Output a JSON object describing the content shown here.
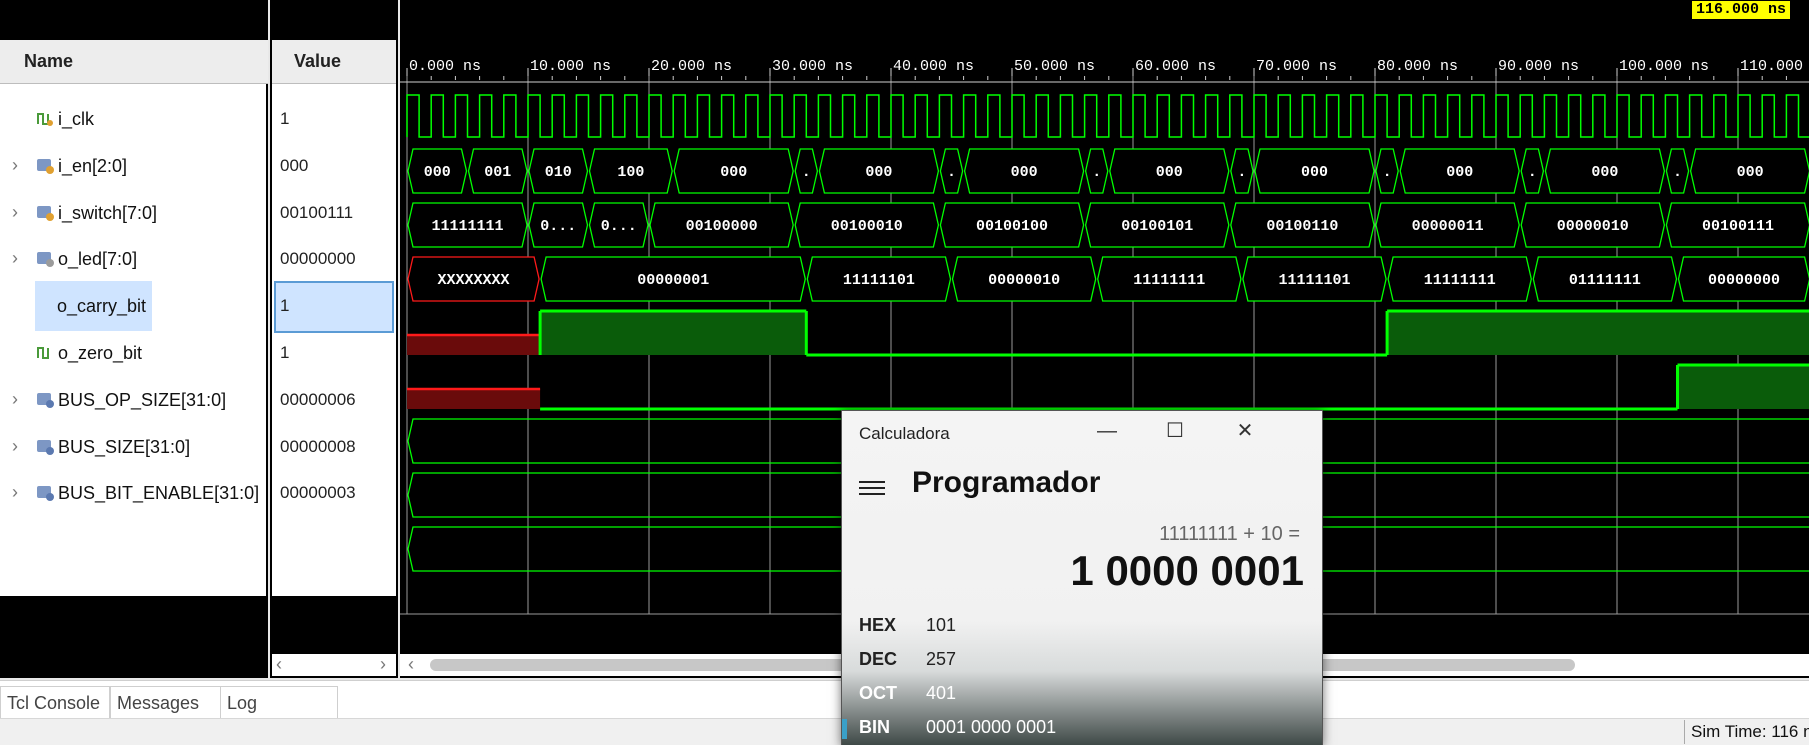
{
  "signals_header": {
    "name_col": "Name",
    "value_col": "Value"
  },
  "signals": [
    {
      "name": "i_clk",
      "value": "1",
      "expandable": false,
      "selected": false,
      "icon": "clock-signal-icon"
    },
    {
      "name": "i_en[2:0]",
      "value": "000",
      "expandable": true,
      "selected": false,
      "icon": "input-bus-icon"
    },
    {
      "name": "i_switch[7:0]",
      "value": "00100111",
      "expandable": true,
      "selected": false,
      "icon": "input-bus-icon"
    },
    {
      "name": "o_led[7:0]",
      "value": "00000000",
      "expandable": true,
      "selected": false,
      "icon": "output-bus-icon"
    },
    {
      "name": "o_carry_bit",
      "value": "1",
      "expandable": false,
      "selected": true,
      "icon": "bit-signal-icon"
    },
    {
      "name": "o_zero_bit",
      "value": "1",
      "expandable": false,
      "selected": false,
      "icon": "bit-signal-icon"
    },
    {
      "name": "BUS_OP_SIZE[31:0]",
      "value": "00000006",
      "expandable": true,
      "selected": false,
      "icon": "parameter-bus-icon"
    },
    {
      "name": "BUS_SIZE[31:0]",
      "value": "00000008",
      "expandable": true,
      "selected": false,
      "icon": "parameter-bus-icon"
    },
    {
      "name": "BUS_BIT_ENABLE[31:0]",
      "value": "00000003",
      "expandable": true,
      "selected": false,
      "icon": "parameter-bus-icon"
    }
  ],
  "waveform": {
    "cursor_label": "116.000 ns",
    "time_ticks": [
      "0.000 ns",
      "10.000 ns",
      "20.000 ns",
      "30.000 ns",
      "40.000 ns",
      "50.000 ns",
      "60.000 ns",
      "70.000 ns",
      "80.000 ns",
      "90.000 ns",
      "100.000 ns",
      "110.000"
    ],
    "i_en": [
      {
        "t0": 0,
        "t1": 5,
        "label": "000"
      },
      {
        "t0": 5,
        "t1": 10,
        "label": "001"
      },
      {
        "t0": 10,
        "t1": 15,
        "label": "010"
      },
      {
        "t0": 15,
        "t1": 22,
        "label": "100"
      },
      {
        "t0": 22,
        "t1": 32,
        "label": "000"
      },
      {
        "t0": 32,
        "t1": 34,
        "label": "."
      },
      {
        "t0": 34,
        "t1": 44,
        "label": "000"
      },
      {
        "t0": 44,
        "t1": 46,
        "label": "."
      },
      {
        "t0": 46,
        "t1": 56,
        "label": "000"
      },
      {
        "t0": 56,
        "t1": 58,
        "label": "."
      },
      {
        "t0": 58,
        "t1": 68,
        "label": "000"
      },
      {
        "t0": 68,
        "t1": 70,
        "label": "."
      },
      {
        "t0": 70,
        "t1": 80,
        "label": "000"
      },
      {
        "t0": 80,
        "t1": 82,
        "label": "."
      },
      {
        "t0": 82,
        "t1": 92,
        "label": "000"
      },
      {
        "t0": 92,
        "t1": 94,
        "label": "."
      },
      {
        "t0": 94,
        "t1": 104,
        "label": "000"
      },
      {
        "t0": 104,
        "t1": 106,
        "label": "."
      },
      {
        "t0": 106,
        "t1": 116,
        "label": "000"
      }
    ],
    "i_switch": [
      {
        "t0": 0,
        "t1": 10,
        "label": "11111111"
      },
      {
        "t0": 10,
        "t1": 15,
        "label": "0..."
      },
      {
        "t0": 15,
        "t1": 20,
        "label": "0..."
      },
      {
        "t0": 20,
        "t1": 32,
        "label": "00100000"
      },
      {
        "t0": 32,
        "t1": 44,
        "label": "00100010"
      },
      {
        "t0": 44,
        "t1": 56,
        "label": "00100100"
      },
      {
        "t0": 56,
        "t1": 68,
        "label": "00100101"
      },
      {
        "t0": 68,
        "t1": 80,
        "label": "00100110"
      },
      {
        "t0": 80,
        "t1": 92,
        "label": "00000011"
      },
      {
        "t0": 92,
        "t1": 104,
        "label": "00000010"
      },
      {
        "t0": 104,
        "t1": 116,
        "label": "00100111"
      }
    ],
    "o_led": [
      {
        "t0": 0,
        "t1": 11,
        "label": "XXXXXXXX",
        "unknown": true
      },
      {
        "t0": 11,
        "t1": 33,
        "label": "00000001"
      },
      {
        "t0": 33,
        "t1": 45,
        "label": "11111101"
      },
      {
        "t0": 45,
        "t1": 57,
        "label": "00000010"
      },
      {
        "t0": 57,
        "t1": 69,
        "label": "11111111"
      },
      {
        "t0": 69,
        "t1": 81,
        "label": "11111101"
      },
      {
        "t0": 81,
        "t1": 93,
        "label": "11111111"
      },
      {
        "t0": 93,
        "t1": 105,
        "label": "01111111"
      },
      {
        "t0": 105,
        "t1": 116,
        "label": "00000000"
      }
    ],
    "o_carry": [
      {
        "t0": 0,
        "t1": 11,
        "v": "x"
      },
      {
        "t0": 11,
        "t1": 33,
        "v": 1
      },
      {
        "t0": 33,
        "t1": 81,
        "v": 0
      },
      {
        "t0": 81,
        "t1": 116,
        "v": 1
      }
    ],
    "o_zero": [
      {
        "t0": 0,
        "t1": 11,
        "v": "x"
      },
      {
        "t0": 11,
        "t1": 105,
        "v": 0
      },
      {
        "t0": 105,
        "t1": 116,
        "v": 1
      }
    ],
    "colors": {
      "wave": "#00ff00",
      "fill": "#0a5c0a",
      "unknown": "#ff1a1a",
      "unknown_fill": "#6a0b0b",
      "grid": "#9a9a9a",
      "cursor": "#ffff00"
    }
  },
  "bottom_tabs": [
    "Tcl Console",
    "Messages",
    "Log"
  ],
  "status": {
    "sim_time": "Sim Time: 116 n"
  },
  "calculator": {
    "title": "Calculadora",
    "mode": "Programador",
    "expression": "11111111 + 10 =",
    "result": "1 0000 0001",
    "bases": [
      {
        "label": "HEX",
        "value": "101",
        "active": false
      },
      {
        "label": "DEC",
        "value": "257",
        "active": false
      },
      {
        "label": "OCT",
        "value": "401",
        "active": false
      },
      {
        "label": "BIN",
        "value": "0001 0000 0001",
        "active": true
      }
    ]
  }
}
